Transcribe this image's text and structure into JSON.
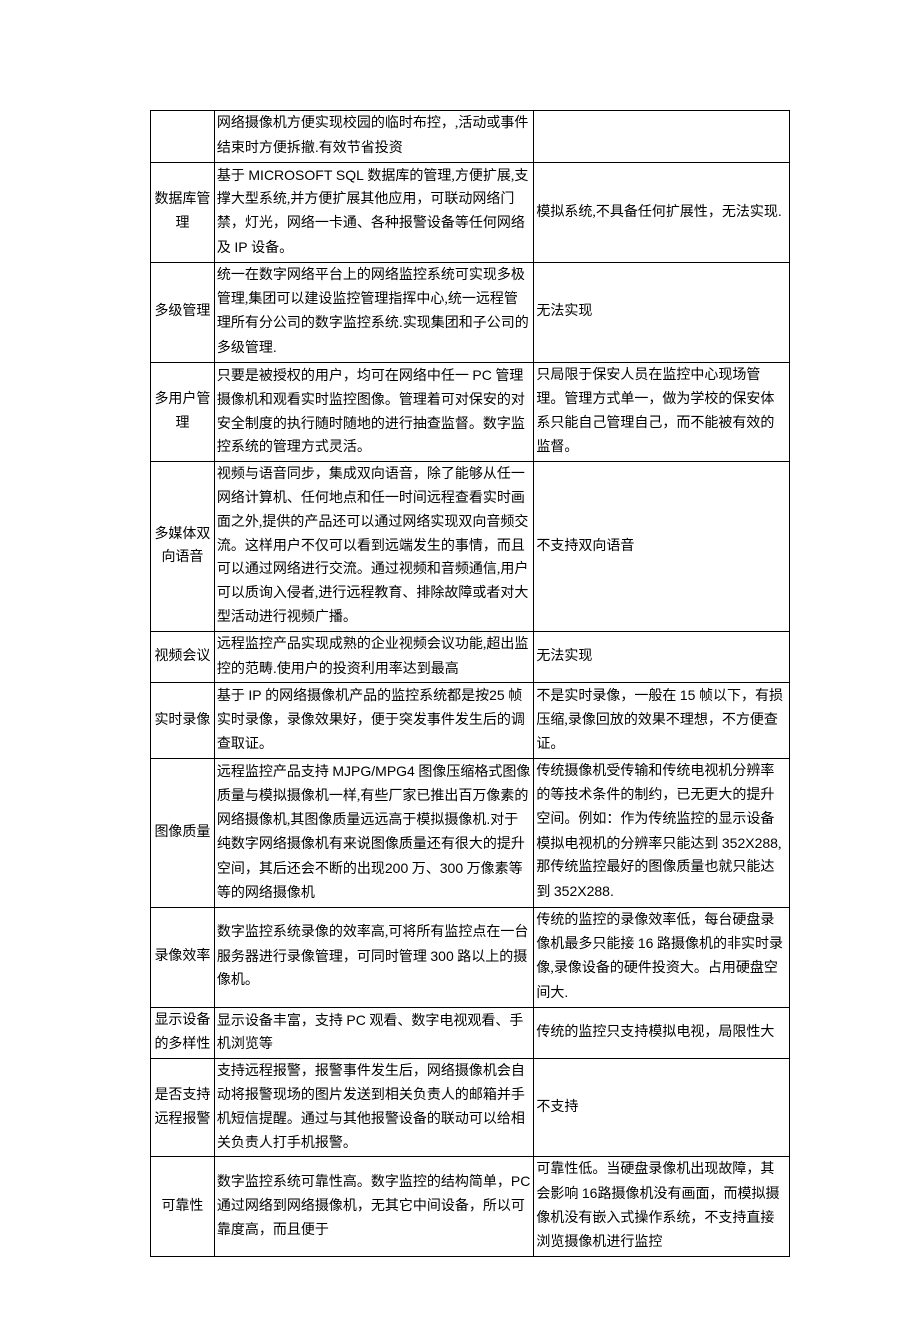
{
  "rows": [
    {
      "label": "",
      "digital": "网络摄像机方便实现校园的临时布控，,活动或事件结束时方便拆撤.有效节省投资",
      "analog": ""
    },
    {
      "label": "数据库管理",
      "digital": "基于 MICROSOFT SQL 数据库的管理,方便扩展,支撑大型系统,并方便扩展其他应用，可联动网络门禁，灯光，网络一卡通、各种报警设备等任何网络及 IP 设备。",
      "analog": "模拟系统,不具备任何扩展性，无法实现."
    },
    {
      "label": "多级管理",
      "digital": "统一在数字网络平台上的网络监控系统可实现多极管理,集团可以建设监控管理指挥中心,统一远程管理所有分公司的数字监控系统.实现集团和子公司的多级管理.",
      "analog": "无法实现"
    },
    {
      "label": "多用户管理",
      "digital": "只要是被授权的用户，均可在网络中任一 PC 管理摄像机和观看实时监控图像。管理着可对保安的对安全制度的执行随时随地的进行抽查监督。数字监控系统的管理方式灵活。",
      "analog": "只局限于保安人员在监控中心现场管理。管理方式单一，做为学校的保安体系只能自己管理自己，而不能被有效的监督。"
    },
    {
      "label": "多媒体双向语音",
      "digital": "视频与语音同步，集成双向语音，除了能够从任一网络计算机、任何地点和任一时间远程查看实时画面之外,提供的产品还可以通过网络实现双向音频交流。这样用户不仅可以看到远端发生的事情，而且可以通过网络进行交流。通过视频和音频通信,用户可以质询入侵者,进行远程教育、排除故障或者对大型活动进行视频广播。",
      "analog": "不支持双向语音"
    },
    {
      "label": "视频会议",
      "digital": "远程监控产品实现成熟的企业视频会议功能,超出监控的范畴.使用户的投资利用率达到最高",
      "analog": "无法实现"
    },
    {
      "label": "实时录像",
      "digital": "基于 IP 的网络摄像机产品的监控系统都是按25 帧实时录像，录像效果好，便于突发事件发生后的调查取证。",
      "analog": "不是实时录像，一般在 15 帧以下，有损压缩,录像回放的效果不理想，不方便查证。"
    },
    {
      "label": "图像质量",
      "digital": "远程监控产品支持 MJPG/MPG4 图像压缩格式图像质量与模拟摄像机一样,有些厂家已推出百万像素的网络摄像机,其图像质量远远高于模拟摄像机.对于纯数字网络摄像机有来说图像质量还有很大的提升空间，其后还会不断的出现200 万、300 万像素等等的网络摄像机",
      "analog": "传统摄像机受传输和传统电视机分辨率的等技术条件的制约，已无更大的提升空间。例如：作为传统监控的显示设备模拟电视机的分辨率只能达到 352X288,那传统监控最好的图像质量也就只能达到 352X288."
    },
    {
      "label": "录像效率",
      "digital": "数字监控系统录像的效率高,可将所有监控点在一台服务器进行录像管理，可同时管理 300 路以上的摄像机。",
      "analog": "传统的监控的录像效率低，每台硬盘录像机最多只能接 16 路摄像机的非实时录像,录像设备的硬件投资大。占用硬盘空间大."
    },
    {
      "label": "显示设备的多样性",
      "digital": "显示设备丰富，支持 PC 观看、数字电视观看、手机浏览等",
      "analog": "传统的监控只支持模拟电视，局限性大"
    },
    {
      "label": "是否支持远程报警",
      "digital": "支持远程报警，报警事件发生后，网络摄像机会自动将报警现场的图片发送到相关负责人的邮箱并手机短信提醒。通过与其他报警设备的联动可以给相关负责人打手机报警。",
      "analog": "不支持"
    },
    {
      "label": "可靠性",
      "digital": "数字监控系统可靠性高。数字监控的结构简单，PC 通过网络到网络摄像机，无其它中间设备，所以可靠度高，而且便于",
      "analog": "可靠性低。当硬盘录像机出现故障，其会影响 16路摄像机没有画面，而模拟摄像机没有嵌入式操作系统，不支持直接浏览摄像机进行监控"
    }
  ]
}
